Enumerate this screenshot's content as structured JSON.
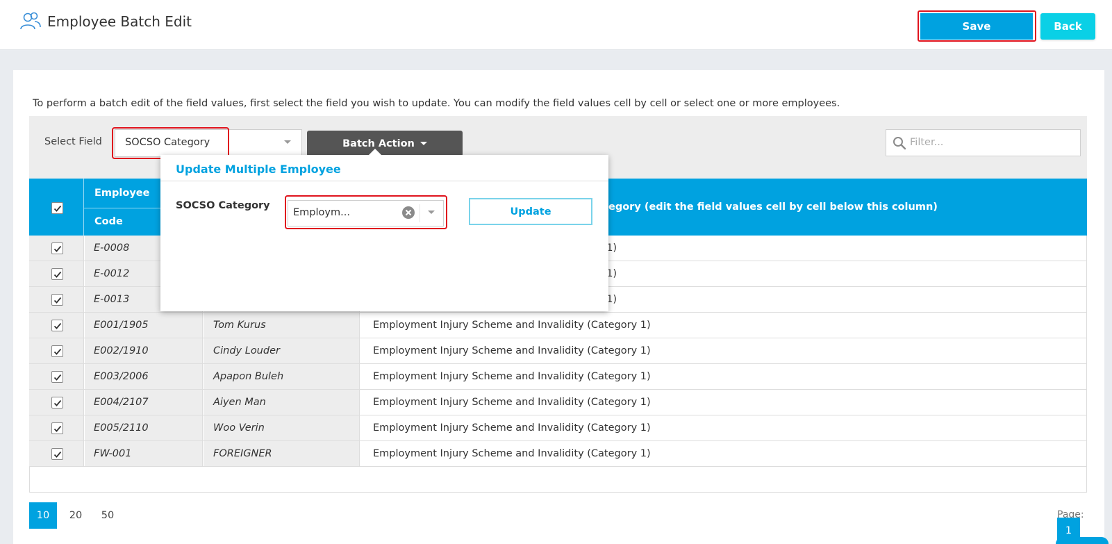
{
  "header": {
    "title": "Employee Batch Edit",
    "icon": "users-icon",
    "save_label": "Save",
    "back_label": "Back"
  },
  "instructions": "To perform a batch edit of the field values, first select the field you wish to update. You can modify the field values cell by cell or select one or more employees.",
  "toolbar": {
    "select_field_label": "Select Field",
    "select_field_value": "SOCSO Category",
    "batch_action_label": "Batch Action",
    "filter_placeholder": "Filter..."
  },
  "table": {
    "header_employee": "Employee",
    "header_code": "Code",
    "header_value_column": "egory (edit the field values cell by cell below this column)",
    "rows": [
      {
        "code": "E-0008",
        "name": "",
        "value": "y 1)",
        "checked": true
      },
      {
        "code": "E-0012",
        "name": "",
        "value": "y 1)",
        "checked": true
      },
      {
        "code": "E-0013",
        "name": "",
        "value": "y 1)",
        "checked": true
      },
      {
        "code": "E001/1905",
        "name": "Tom Kurus",
        "value": "Employment Injury Scheme and Invalidity (Category 1)",
        "checked": true
      },
      {
        "code": "E002/1910",
        "name": "Cindy Louder",
        "value": "Employment Injury Scheme and Invalidity (Category 1)",
        "checked": true
      },
      {
        "code": "E003/2006",
        "name": "Apapon Buleh",
        "value": "Employment Injury Scheme and Invalidity (Category 1)",
        "checked": true
      },
      {
        "code": "E004/2107",
        "name": "Aiyen Man",
        "value": "Employment Injury Scheme and Invalidity (Category 1)",
        "checked": true
      },
      {
        "code": "E005/2110",
        "name": "Woo Verin",
        "value": "Employment Injury Scheme and Invalidity (Category 1)",
        "checked": true
      },
      {
        "code": "FW-001",
        "name": "FOREIGNER",
        "value": "Employment Injury Scheme and Invalidity (Category 1)",
        "checked": true
      }
    ]
  },
  "pagination": {
    "sizes": [
      "10",
      "20",
      "50"
    ],
    "active_size": "10",
    "page_label": "Page:",
    "current_page": "1"
  },
  "popup": {
    "title": "Update Multiple Employee",
    "field_label": "SOCSO Category",
    "select_value": "Employm...",
    "update_label": "Update"
  },
  "colors": {
    "primary": "#00a2e0",
    "back": "#0ad0e6",
    "batch": "#555555",
    "highlight": "#e0141e"
  }
}
